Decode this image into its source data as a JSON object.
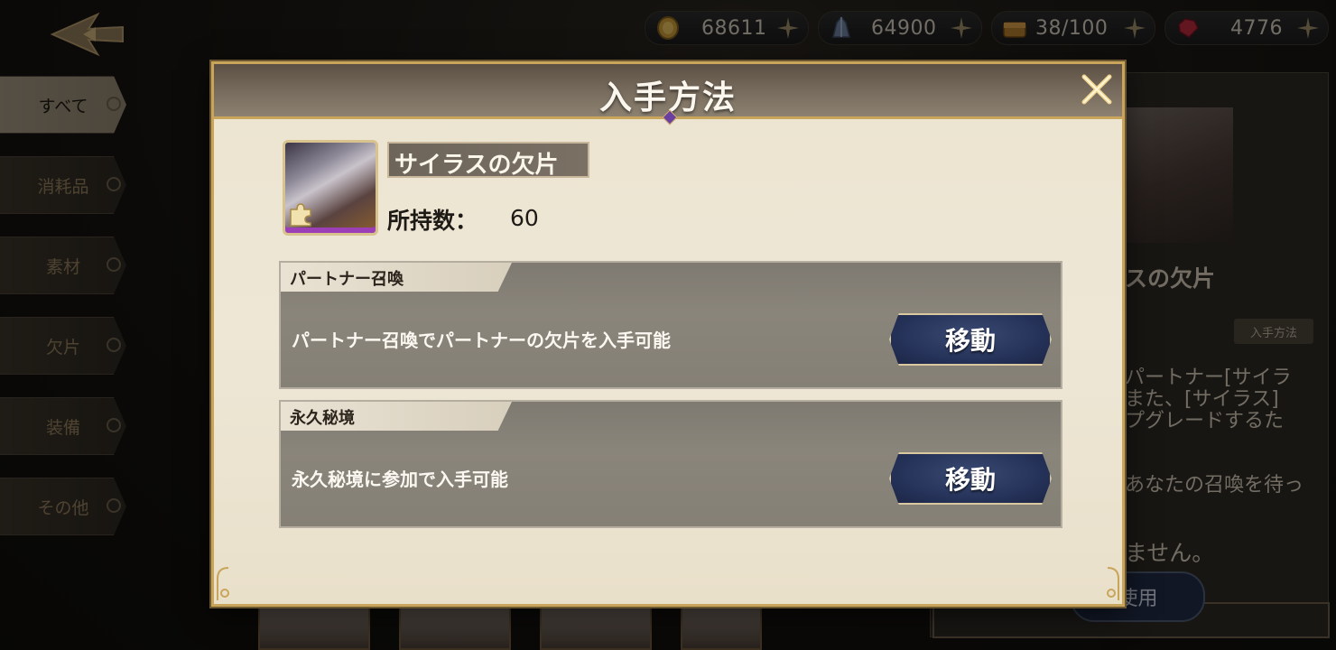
{
  "currencies": [
    {
      "name": "gold-coin-icon",
      "value": "68611"
    },
    {
      "name": "crystal-icon",
      "value": "64900"
    },
    {
      "name": "treasure-chest-icon",
      "value": "38/100"
    },
    {
      "name": "ruby-gem-icon",
      "value": "4776"
    }
  ],
  "sidebar": {
    "items": [
      {
        "label": "すべて"
      },
      {
        "label": "消耗品"
      },
      {
        "label": "素材"
      },
      {
        "label": "欠片"
      },
      {
        "label": "装備"
      },
      {
        "label": "その他"
      }
    ]
  },
  "detail_panel": {
    "name": "スの欠片",
    "acquire_label": "入手方法",
    "desc_lines": [
      "パートナー[サイラ",
      "また、[サイラス]",
      "プグレードするた"
    ],
    "line2": "あなたの召喚を待っ",
    "line3": "ません。",
    "use_label": "使用"
  },
  "modal": {
    "title": "入手方法",
    "item": {
      "name": "サイラスの欠片",
      "owned_label": "所持数：",
      "owned_value": "60"
    },
    "sources": [
      {
        "tab": "パートナー召喚",
        "description": "パートナー召喚でパートナーの欠片を入手可能",
        "button": "移動"
      },
      {
        "tab": "永久秘境",
        "description": "永久秘境に参加で入手可能",
        "button": "移動"
      }
    ]
  },
  "colors": {
    "gold_border": "#c9a55c",
    "modal_bg": "#ece4d0",
    "button_navy": "#26335a",
    "rarity_purple": "#9c3fb6"
  }
}
